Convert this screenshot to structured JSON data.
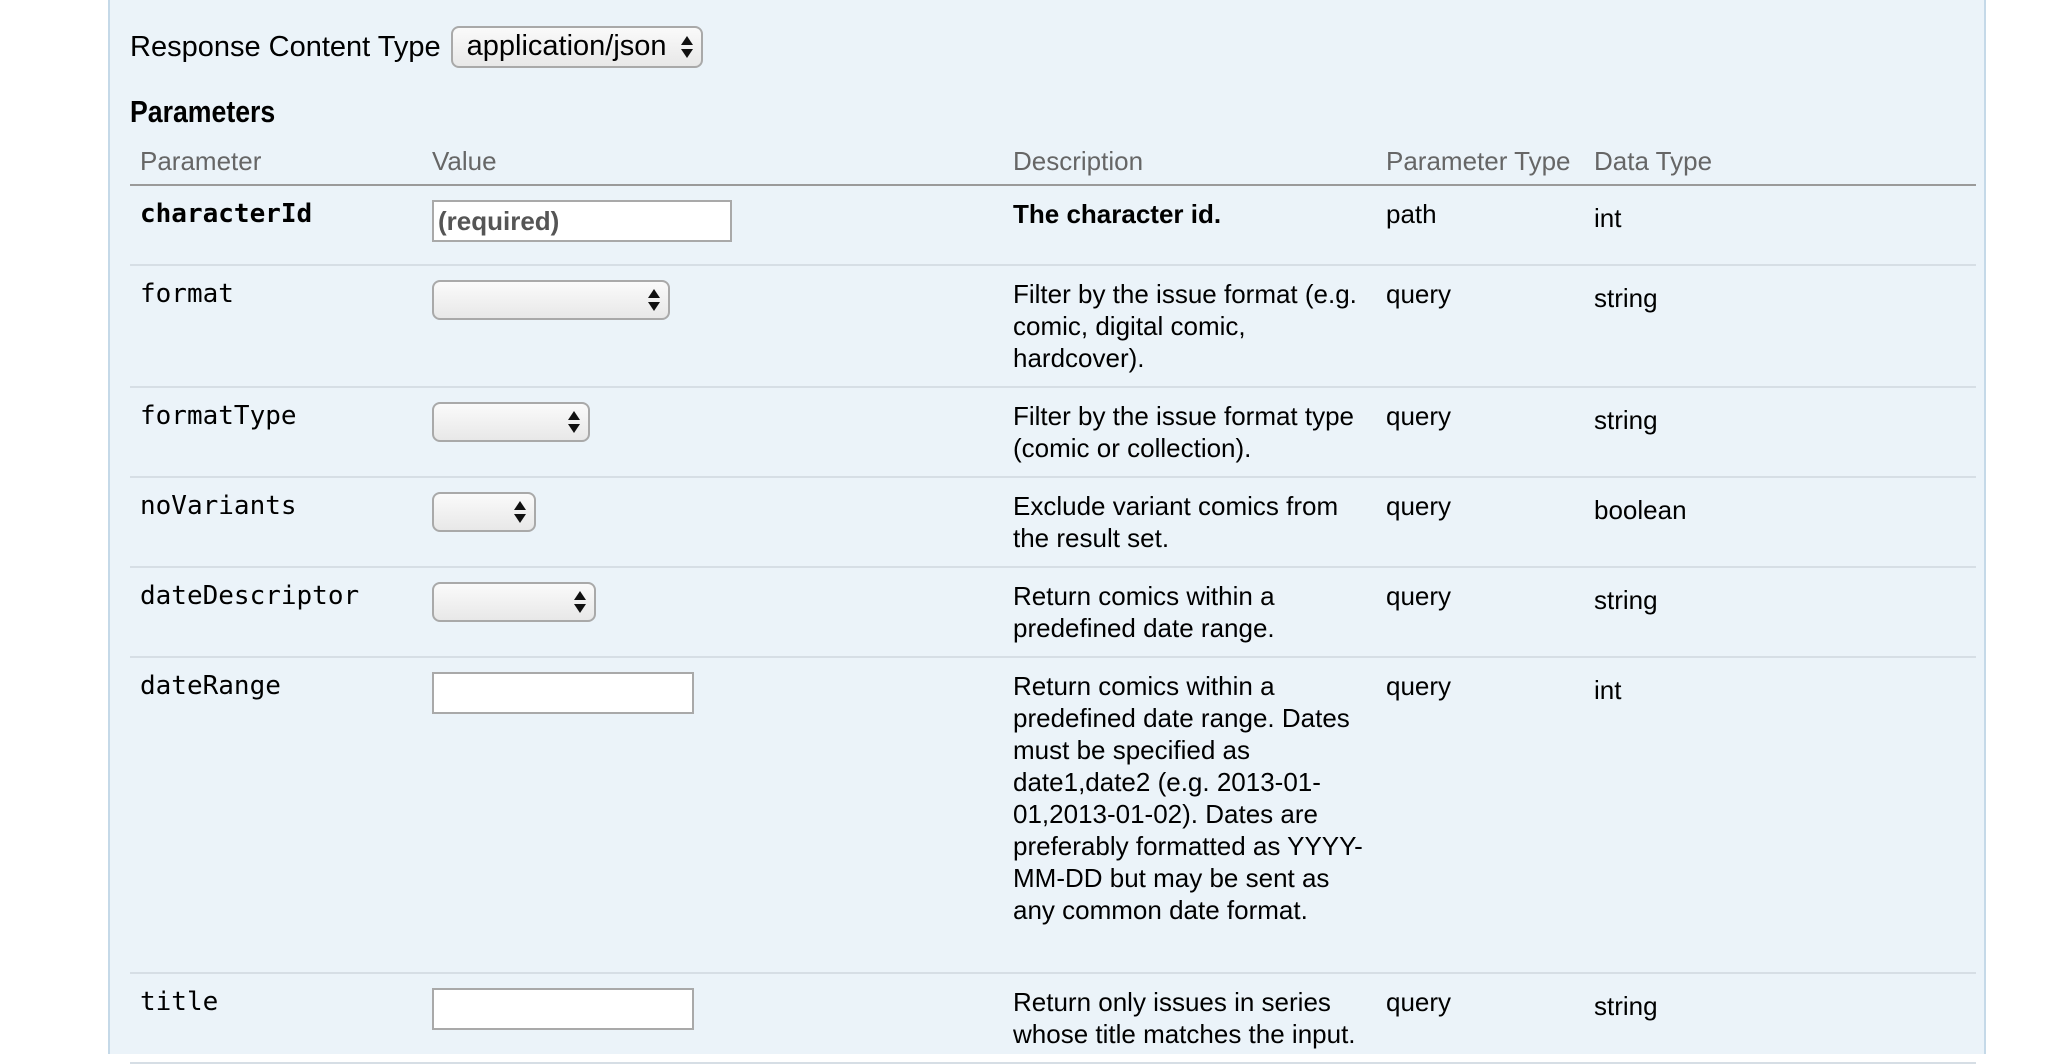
{
  "response_content_type": {
    "label": "Response Content Type",
    "selected": "application/json"
  },
  "parameters": {
    "heading": "Parameters",
    "columns": [
      "Parameter",
      "Value",
      "Description",
      "Parameter Type",
      "Data Type"
    ],
    "rows": [
      {
        "name": "characterId",
        "input_kind": "text",
        "placeholder": "(required)",
        "description": "The character id.",
        "param_type": "path",
        "data_type": "int"
      },
      {
        "name": "format",
        "input_kind": "select",
        "selected": "",
        "description": "Filter by the issue format (e.g. comic, digital comic, hardcover).",
        "param_type": "query",
        "data_type": "string"
      },
      {
        "name": "formatType",
        "input_kind": "select",
        "selected": "",
        "description": "Filter by the issue format type (comic or collection).",
        "param_type": "query",
        "data_type": "string"
      },
      {
        "name": "noVariants",
        "input_kind": "select",
        "selected": "",
        "description": "Exclude variant comics from the result set.",
        "param_type": "query",
        "data_type": "boolean"
      },
      {
        "name": "dateDescriptor",
        "input_kind": "select",
        "selected": "",
        "description": "Return comics within a predefined date range.",
        "param_type": "query",
        "data_type": "string"
      },
      {
        "name": "dateRange",
        "input_kind": "text",
        "placeholder": "",
        "description": "Return comics within a predefined date range. Dates must be specified as date1,date2 (e.g. 2013-01-01,2013-01-02). Dates are preferably formatted as YYYY-MM-DD but may be sent as any common date format.",
        "param_type": "query",
        "data_type": "int"
      },
      {
        "name": "title",
        "input_kind": "text",
        "placeholder": "",
        "description": "Return only issues in series whose title matches the input.",
        "param_type": "query",
        "data_type": "string"
      }
    ]
  }
}
